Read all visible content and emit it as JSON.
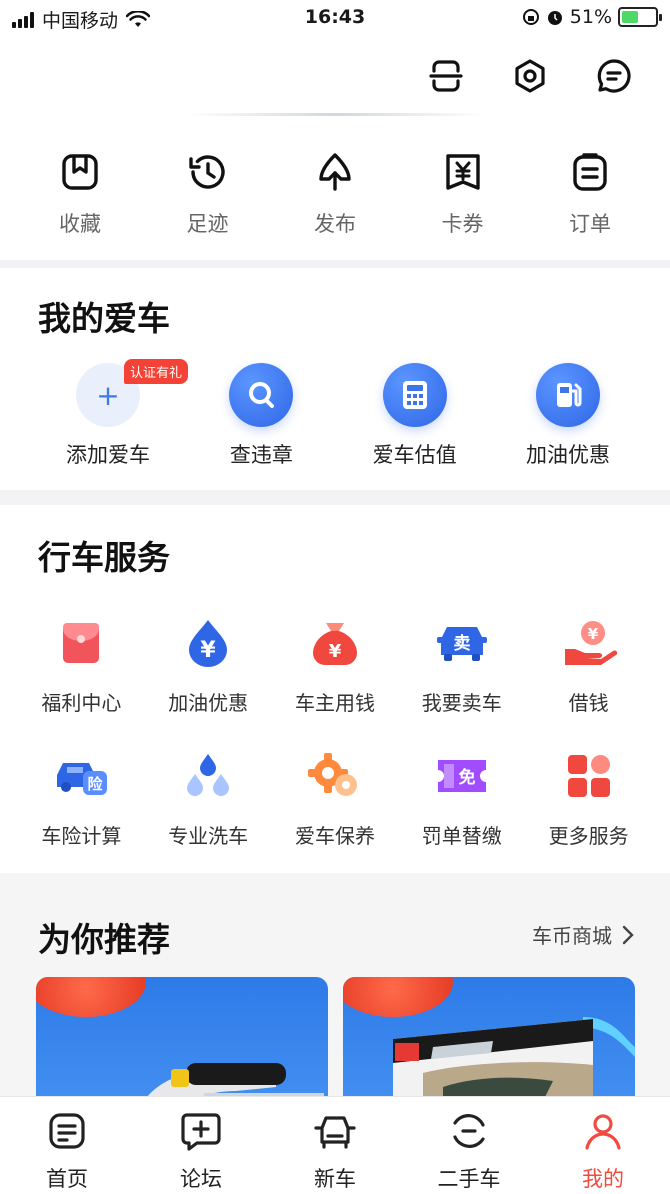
{
  "status_bar": {
    "carrier": "中国移动",
    "time": "16:43",
    "battery": "51%"
  },
  "header": {
    "icons": [
      "scan-icon",
      "settings-icon",
      "message-icon"
    ],
    "quick_links": [
      {
        "label": "收藏",
        "icon": "favorite-icon"
      },
      {
        "label": "足迹",
        "icon": "history-icon"
      },
      {
        "label": "发布",
        "icon": "publish-icon"
      },
      {
        "label": "卡券",
        "icon": "coupon-icon"
      },
      {
        "label": "订单",
        "icon": "order-icon"
      }
    ]
  },
  "my_cars": {
    "title": "我的爱车",
    "badge": "认证有礼",
    "items": [
      {
        "label": "添加爱车",
        "icon": "add-icon"
      },
      {
        "label": "查违章",
        "icon": "search-icon"
      },
      {
        "label": "爱车估值",
        "icon": "calculator-icon"
      },
      {
        "label": "加油优惠",
        "icon": "fuel-icon"
      }
    ]
  },
  "services": {
    "title": "行车服务",
    "items": [
      {
        "label": "福利中心",
        "icon": "red-envelope-icon"
      },
      {
        "label": "加油优惠",
        "icon": "yuan-drop-icon"
      },
      {
        "label": "车主用钱",
        "icon": "money-bag-icon"
      },
      {
        "label": "我要卖车",
        "icon": "sell-car-icon"
      },
      {
        "label": "借钱",
        "icon": "loan-hand-icon"
      },
      {
        "label": "车险计算",
        "icon": "insurance-car-icon"
      },
      {
        "label": "专业洗车",
        "icon": "water-drops-icon"
      },
      {
        "label": "爱车保养",
        "icon": "gear-icon"
      },
      {
        "label": "罚单替缴",
        "icon": "ticket-icon"
      },
      {
        "label": "更多服务",
        "icon": "grid-icon"
      }
    ],
    "glyphs": {
      "sell": "卖",
      "insurance": "险",
      "ticket": "免",
      "yuan": "¥"
    }
  },
  "recommend": {
    "title": "为你推荐",
    "more": "车币商城",
    "cards": [
      "banner-vacuum",
      "banner-lego-speed"
    ]
  },
  "tabbar": {
    "items": [
      {
        "label": "首页",
        "icon": "home-icon"
      },
      {
        "label": "论坛",
        "icon": "forum-icon"
      },
      {
        "label": "新车",
        "icon": "new-car-icon"
      },
      {
        "label": "二手车",
        "icon": "used-car-icon"
      },
      {
        "label": "我的",
        "icon": "profile-icon",
        "active": true
      }
    ]
  },
  "colors": {
    "accent_red": "#f04b3e",
    "blue": "#2f66e6",
    "battery_green": "#4cd964"
  }
}
